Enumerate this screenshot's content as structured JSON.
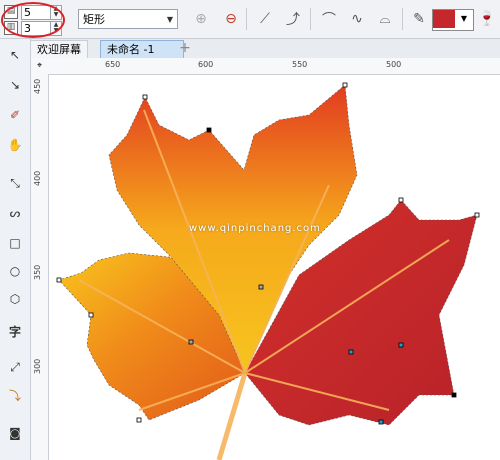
{
  "property_bar": {
    "row_count": "5",
    "col_count": "3",
    "shape_type": "矩形"
  },
  "tabs": {
    "welcome": "欢迎屏幕",
    "document": "未命名 -1",
    "add": "+"
  },
  "rulers": {
    "horizontal": [
      "650",
      "600",
      "550",
      "500"
    ],
    "vertical": [
      "450",
      "400",
      "350",
      "300"
    ]
  },
  "canvas": {
    "watermark": "www.qinpinchang.com"
  },
  "colors": {
    "fill_swatch": "#c4282c",
    "leaf_red": "#c4282c",
    "leaf_orange": "#f08a1a",
    "leaf_yellow": "#f8c21c",
    "highlight_ring": "#d9232a"
  },
  "tools": [
    "pick-tool-icon",
    "shape-tool-icon",
    "smear-tool-icon",
    "pan-tool-icon",
    "bezier-tool-icon",
    "artistic-media-icon",
    "rectangle-tool-icon",
    "ellipse-tool-icon",
    "polygon-tool-icon",
    "text-tool-icon",
    "parallel-dimension-icon",
    "connector-icon",
    "fill-tool-icon"
  ]
}
